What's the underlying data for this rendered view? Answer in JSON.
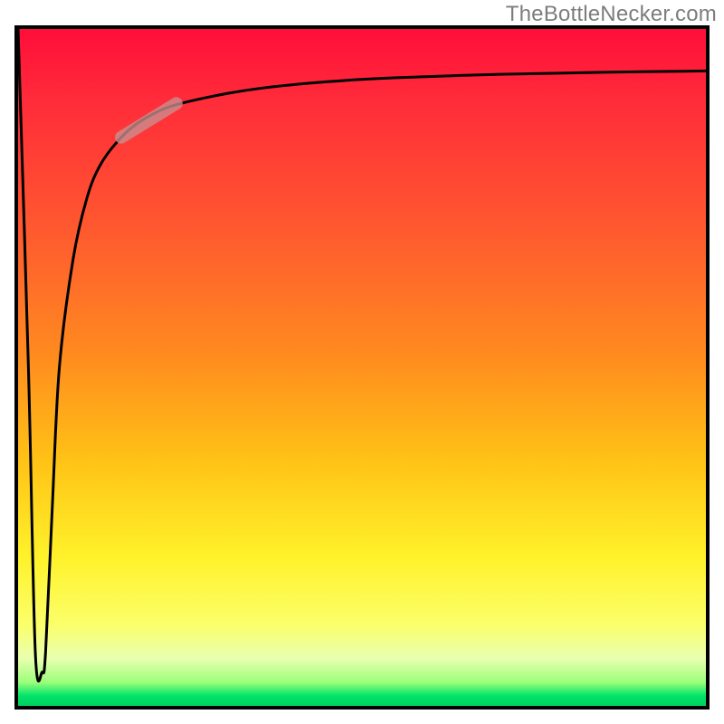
{
  "attribution": "TheBottleNecker.com",
  "colors": {
    "attribution_text": "#7d7d7d",
    "border": "#000000",
    "curve": "#000000",
    "marker": "#c99090",
    "gradient_top": "#ff0e3a",
    "gradient_green": "#00d060"
  },
  "chart_data": {
    "type": "line",
    "title": "",
    "xlabel": "",
    "ylabel": "",
    "xlim": [
      0,
      100
    ],
    "ylim": [
      0,
      100
    ],
    "grid": false,
    "legend": false,
    "background": "vertical-gradient red→orange→yellow→green",
    "x": [
      0,
      1.5,
      2.5,
      3.5,
      4,
      5,
      6,
      8,
      10,
      12,
      15,
      18,
      22,
      28,
      35,
      45,
      55,
      70,
      85,
      100
    ],
    "values": [
      100,
      50,
      8,
      5,
      8,
      30,
      50,
      66,
      75,
      80,
      84,
      86.5,
      88.5,
      90,
      91.2,
      92.2,
      92.8,
      93.3,
      93.6,
      93.8
    ],
    "note": "Axis values are relative 0–100 percentages read from unlabeled axes; curve shows a sharp initial dip near x≈3 then saturating rise toward ~94%.",
    "marker_segment": {
      "x_start": 15,
      "x_end": 23,
      "y_start": 84,
      "y_end": 89
    }
  }
}
